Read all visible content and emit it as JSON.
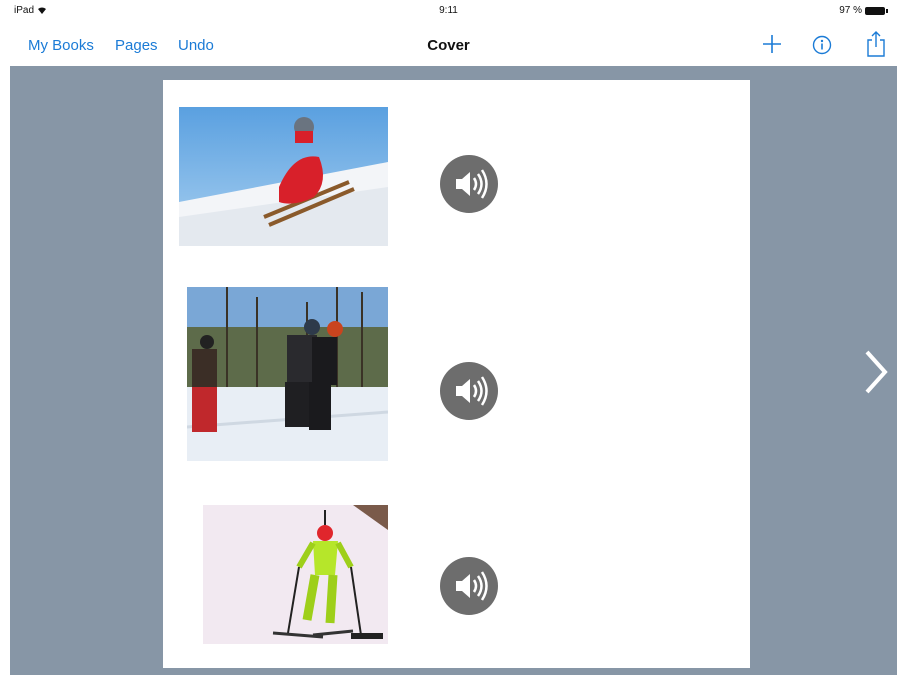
{
  "status_bar": {
    "device": "iPad",
    "time": "9:11",
    "battery": "97 %"
  },
  "nav_bar": {
    "my_books_label": "My Books",
    "pages_label": "Pages",
    "undo_label": "Undo",
    "title": "Cover",
    "icons": [
      "plus-icon",
      "info-icon",
      "share-icon"
    ]
  },
  "page": {
    "items": [
      {
        "photo": "child-on-sled-photo",
        "audio": "speaker-icon"
      },
      {
        "photo": "family-skating-photo",
        "audio": "speaker-icon"
      },
      {
        "photo": "skier-photo",
        "audio": "speaker-icon"
      }
    ]
  },
  "colors": {
    "accent": "#1b7bd6",
    "canvas": "#8796a6",
    "speaker": "#6d6d6d"
  }
}
